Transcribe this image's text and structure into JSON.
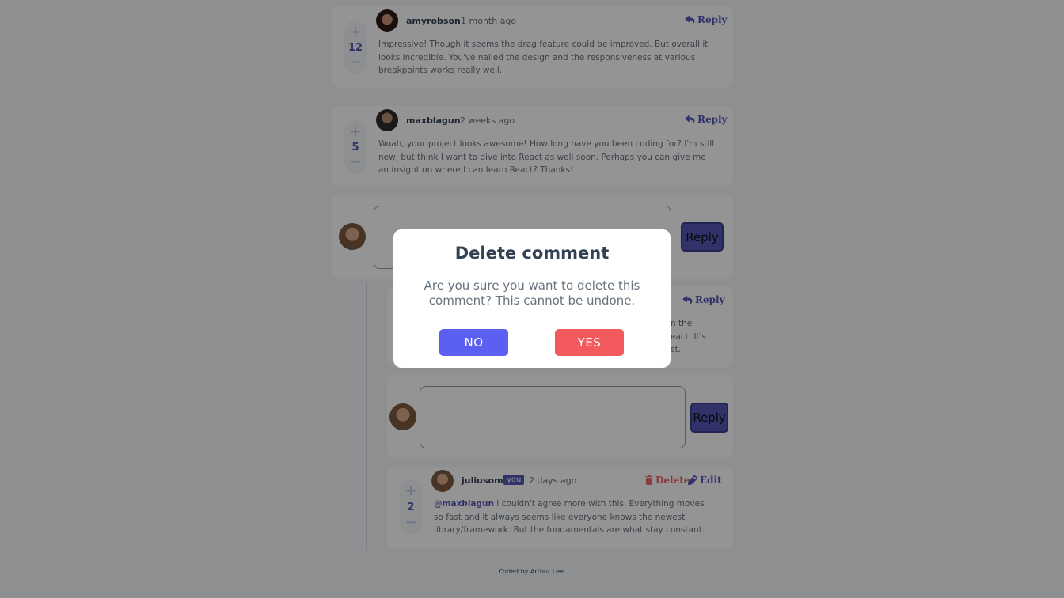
{
  "comments": [
    {
      "username": "amyrobson",
      "date": "1 month ago",
      "score": "12",
      "reply_label": "Reply",
      "content": "Impressive! Though it seems the drag feature could be improved. But overall it looks incredible. You've nailed the design and the responsiveness at various breakpoints works really well."
    },
    {
      "username": "maxblagun",
      "date": "2 weeks ago",
      "score": "5",
      "reply_label": "Reply",
      "content": "Woah, your project looks awesome! How long have you been coding for? I'm still new, but think I want to dive into React as well soon. Perhaps you can give me an insight on where I can learn React? Thanks!"
    }
  ],
  "reply_form": {
    "button_label": "Reply"
  },
  "nested_reply": {
    "reply_label": "Reply",
    "partial_lines": [
      "n the",
      "eact. It's",
      "st."
    ]
  },
  "nested_reply_form": {
    "button_label": "Reply"
  },
  "own_reply": {
    "username": "juliusomo",
    "you_badge": "you",
    "date": "2 days ago",
    "score": "2",
    "delete_label": "Delete",
    "edit_label": "Edit",
    "mention": "@maxblagun",
    "content": " I couldn't agree more with this. Everything moves so fast and it always seems like everyone knows the newest library/framework. But the fundamentals are what stay constant."
  },
  "footer": {
    "prefix": "Coded by",
    "author": "Arthur Lee."
  },
  "modal": {
    "title": "Delete comment",
    "message": "Are you sure you want to delete this comment? This cannot be undone.",
    "no_label": "NO",
    "yes_label": "YES"
  },
  "colors": {
    "primary": "#5357b6",
    "danger": "#ed6468",
    "neutral": "#67727e",
    "background": "#f5f6fa"
  }
}
